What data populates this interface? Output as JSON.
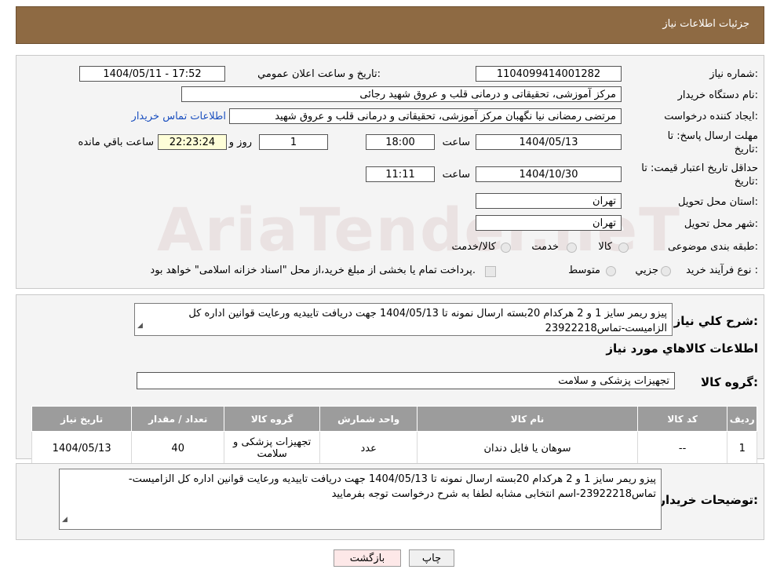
{
  "header": {
    "title": "جزئیات اطلاعات نیاز"
  },
  "watermark": {
    "text": "AriaTender.neT"
  },
  "form": {
    "need_number_label": "شماره نیاز:",
    "need_number": "1104099414001282",
    "announce_label": "تاریخ و ساعت اعلان عمومي:",
    "announce_value": "1404/05/11 - 17:52",
    "buyer_org_label": "نام دستگاه خریدار:",
    "buyer_org": "مرکز آموزشی، تحقیقاتی و درمانی قلب و عروق شهید رجائی",
    "creator_label": "ایجاد کننده درخواست:",
    "creator": "مرتضی رمضانی نیا نگهبان مرکز آموزشی، تحقیقاتی و درمانی قلب و عروق شهید",
    "contact_link": "اطلاعات تماس خریدار",
    "deadline_label_1": "مهلت ارسال پاسخ: تا",
    "deadline_label_2": "تاریخ:",
    "deadline_date": "1404/05/13",
    "time_label": "ساعت",
    "deadline_time": "18:00",
    "days_count": "1",
    "days_label": "روز و",
    "remaining_time": "22:23:24",
    "remaining_label": "ساعت باقي مانده",
    "validity_label_1": "حداقل تاریخ اعتبار قیمت: تا",
    "validity_label_2": "تاریخ:",
    "validity_date": "1404/10/30",
    "validity_time_label": "ساعت",
    "validity_time": "11:11",
    "province_label": "استان محل تحویل:",
    "province": "تهران",
    "city_label": "شهر محل تحویل:",
    "city": "تهران",
    "category_label": "طبقه بندی موضوعی:",
    "category_options": [
      "کالا",
      "خدمت",
      "کالا/خدمت"
    ],
    "process_label": "نوع فرآیند خرید :",
    "process_options": [
      "جزیي",
      "متوسط"
    ],
    "payment_note": "پرداخت تمام یا بخشی از مبلغ خرید،از محل \"اسناد خزانه اسلامی\" خواهد بود."
  },
  "description": {
    "label": "شرح کلي نیاز:",
    "text": "پیزو ریمر سایز 1 و 2 هرکدام 20بسته ارسال نمونه تا 1404/05/13 جهت دریافت تاییدیه ورعایت قوانین اداره کل الزامیست-تماس23922218"
  },
  "goods_info_title": "اطلاعات کالاهاي مورد نیاز",
  "goods_group": {
    "label": "گروه کالا:",
    "value": "تجهیزات پزشکی و سلامت"
  },
  "table": {
    "headers": [
      "ردیف",
      "کد کالا",
      "نام کالا",
      "واحد شمارش",
      "گروه کالا",
      "تعداد / مقدار",
      "تاریخ نیاز"
    ],
    "rows": [
      {
        "index": "1",
        "code": "--",
        "name": "سوهان یا فایل دندان",
        "unit": "عدد",
        "group": "تجهیزات پزشکی و سلامت",
        "qty": "40",
        "date": "1404/05/13"
      }
    ]
  },
  "buyer_notes": {
    "label": "توضیحات خریدار:",
    "text": "پیزو ریمر سایز 1 و 2 هرکدام 20بسته ارسال نمونه تا 1404/05/13 جهت دریافت تاییدیه ورعایت قوانین اداره کل الزامیست-تماس23922218-اسم انتخابی مشابه لطفا به شرح درخواست توجه بفرمایید"
  },
  "buttons": {
    "print": "چاپ",
    "back": "بازگشت"
  },
  "colors": {
    "header": "#8e6a43",
    "table_header": "#9c9c9c",
    "back_button": "#fde8e8",
    "link": "#1a4fbf"
  }
}
